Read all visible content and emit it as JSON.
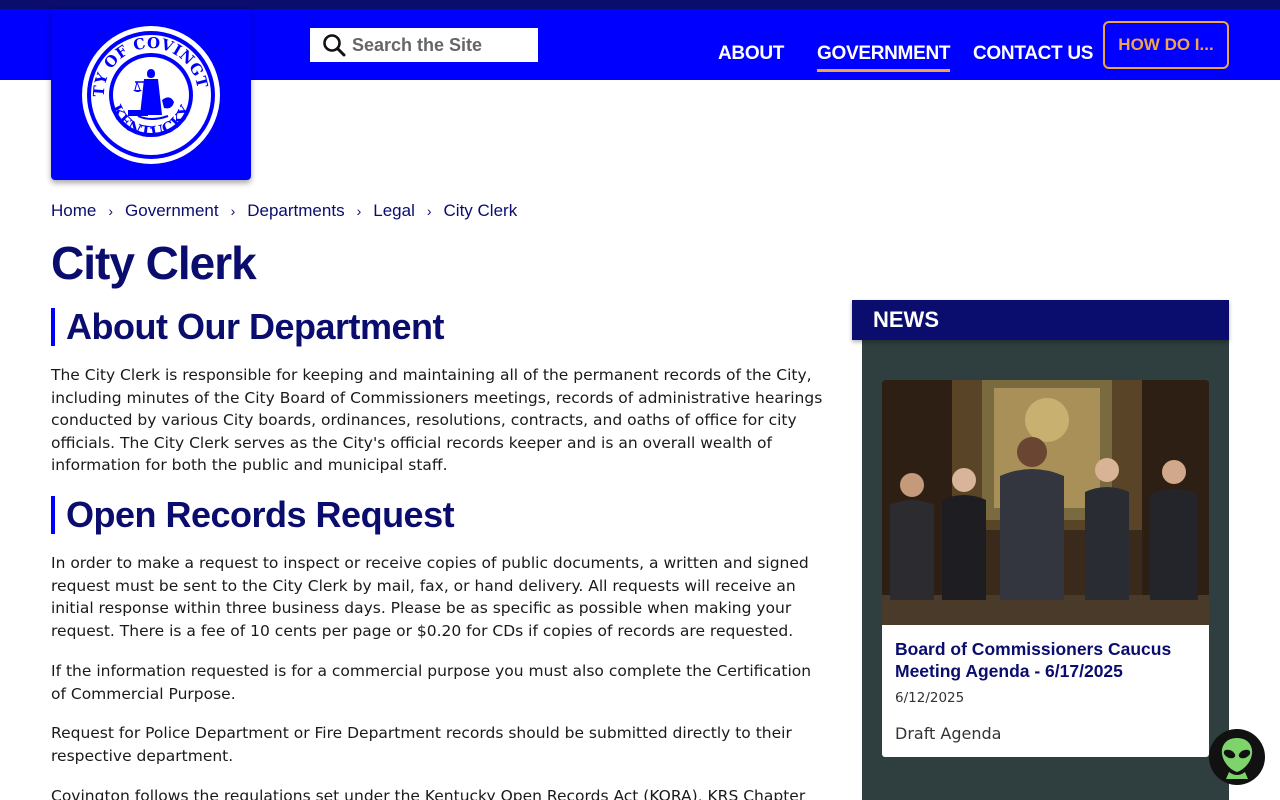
{
  "site": {
    "logo_alt": "City of Covington Kentucky seal",
    "logo_text_top": "CITY OF COVINGTON",
    "logo_text_bottom": "KENTUCKY"
  },
  "search": {
    "placeholder": "Search the Site"
  },
  "nav": {
    "about": "ABOUT",
    "government": "GOVERNMENT",
    "contact": "CONTACT US",
    "how_do_i": "HOW DO I..."
  },
  "breadcrumb": [
    "Home",
    "Government",
    "Departments",
    "Legal",
    "City Clerk"
  ],
  "page": {
    "title": "City Clerk",
    "about_heading": "About Our Department",
    "about_text": "The City Clerk is responsible for keeping and maintaining all of the permanent records of the City, including minutes of the City Board of Commissioners meetings, records of administrative hearings conducted by various City boards, ordinances, resolutions, contracts, and oaths of office for city officials. The City Clerk serves as the City's official records keeper and is an overall wealth of information for both the public and municipal staff.",
    "records_heading": "Open Records Request",
    "records_text_1": "In order to make a request to inspect or receive copies of public documents, a written and signed request must be sent to the City Clerk by mail, fax, or hand delivery. All requests will receive an initial response within three business days. Please be as specific as possible when making your request. There is a fee of 10 cents per page or $0.20 for CDs if copies of records are requested.",
    "records_text_2": "If the information requested is for a commercial purpose you must also complete the Certification of Commercial Purpose.",
    "records_text_3": "Request for Police Department or Fire Department records should be submitted directly to their respective department.",
    "records_text_4": "Covington follows the regulations set under the Kentucky Open Records Act (KORA), KRS Chapter"
  },
  "news": {
    "heading": "NEWS",
    "card": {
      "title": "Board of Commissioners Caucus Meeting Agenda - 6/17/2025",
      "date": "6/12/2025",
      "description": "Draft Agenda"
    }
  },
  "colors": {
    "brand_blue": "#0000ff",
    "navy": "#0a0c6e",
    "accent_orange": "#f2a34b",
    "panel_dark": "#2f3e3f"
  },
  "icons": {
    "search": "search-icon",
    "chevron": "chevron-right-icon",
    "assistant": "alien-icon"
  }
}
